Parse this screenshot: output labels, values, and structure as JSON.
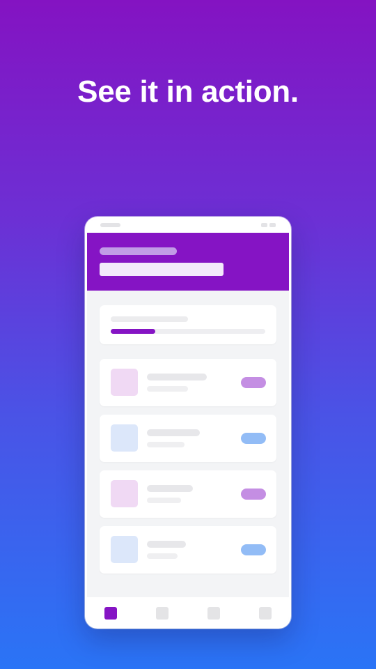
{
  "headline": "See it in action.",
  "colors": {
    "accent": "#8514c4",
    "blue_accent": "#2a74f6",
    "background_top": "#8413c2",
    "background_bottom": "#2a74f6"
  },
  "progress_card": {
    "progress_fraction": 0.29
  },
  "list_items": [
    {
      "thumb_color": "#f0d9f4",
      "pill_color": "#c48ee3"
    },
    {
      "thumb_color": "#dce7fa",
      "pill_color": "#92bcf6"
    },
    {
      "thumb_color": "#f0d9f4",
      "pill_color": "#c48ee3"
    },
    {
      "thumb_color": "#dce7fa",
      "pill_color": "#92bcf6"
    }
  ],
  "bottom_nav": {
    "tabs": [
      {
        "icon": "home-icon",
        "active": true
      },
      {
        "icon": "tab-icon",
        "active": false
      },
      {
        "icon": "tab-icon",
        "active": false
      },
      {
        "icon": "tab-icon",
        "active": false
      }
    ]
  }
}
